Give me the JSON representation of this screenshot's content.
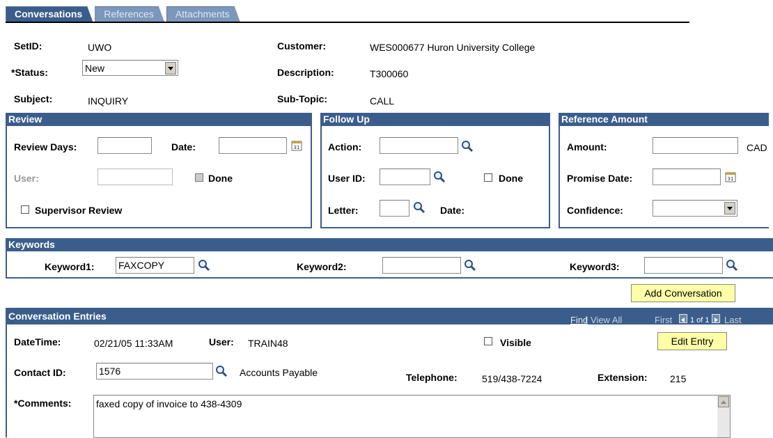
{
  "tabs": [
    "Conversations",
    "References",
    "Attachments"
  ],
  "header": {
    "setid_label": "SetID:",
    "setid_value": "UWO",
    "customer_label": "Customer:",
    "customer_value": "WES000677  Huron University College",
    "status_label": "*Status:",
    "status_value": "New",
    "description_label": "Description:",
    "description_value": "T300060",
    "subject_label": "Subject:",
    "subject_value": "INQUIRY",
    "subtopic_label": "Sub-Topic:",
    "subtopic_value": "CALL"
  },
  "review": {
    "title": "Review",
    "review_days_label": "Review Days:",
    "date_label": "Date:",
    "user_label": "User:",
    "done_label": "Done",
    "supervisor_label": "Supervisor Review"
  },
  "followup": {
    "title": "Follow Up",
    "action_label": "Action:",
    "userid_label": "User ID:",
    "done_label": "Done",
    "letter_label": "Letter:",
    "date_label": "Date:"
  },
  "reference_amount": {
    "title": "Reference Amount",
    "amount_label": "Amount:",
    "currency": "CAD",
    "promise_date_label": "Promise Date:",
    "confidence_label": "Confidence:"
  },
  "keywords": {
    "title": "Keywords",
    "k1_label": "Keyword1:",
    "k1_value": "FAXCOPY",
    "k2_label": "Keyword2:",
    "k2_value": "",
    "k3_label": "Keyword3:",
    "k3_value": ""
  },
  "add_conversation_button": "Add Conversation",
  "entries": {
    "title": "Conversation Entries",
    "find": "Find",
    "sep": "|",
    "view_all": "View All",
    "first": "First",
    "count": "1 of 1",
    "last": "Last",
    "datetime_label": "DateTime:",
    "datetime_value": "02/21/05 11:33AM",
    "user_label": "User:",
    "user_value": "TRAIN48",
    "visible_label": "Visible",
    "edit_entry_button": "Edit Entry",
    "contact_label": "Contact ID:",
    "contact_value": "1576",
    "contact_name": "Accounts Payable",
    "telephone_label": "Telephone:",
    "telephone_value": "519/438-7224",
    "extension_label": "Extension:",
    "extension_value": "215",
    "comments_label": "*Comments:",
    "comments_value": "faxed copy of invoice to 438-4309"
  },
  "colors": {
    "header_bar": "#3b5d8c",
    "button_bg": "#ffffa8"
  }
}
